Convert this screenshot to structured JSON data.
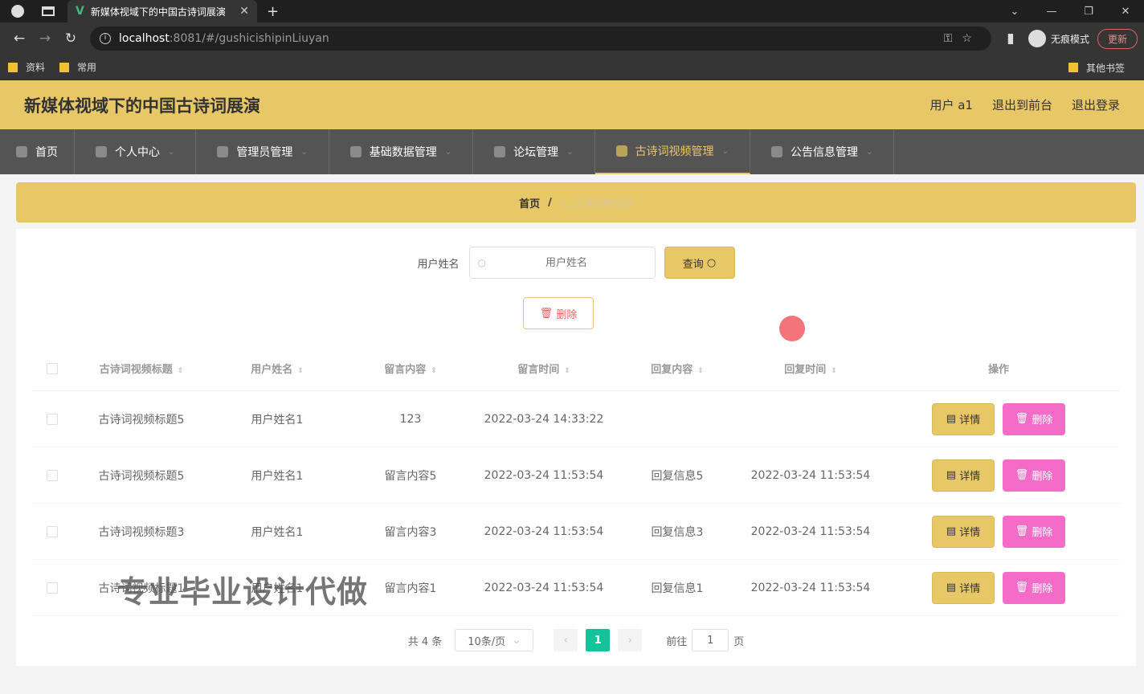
{
  "browser": {
    "tab_title": "新媒体视域下的中国古诗词展演",
    "url_host": "localhost",
    "url_path": ":8081/#/gushicishipinLiuyan",
    "incognito_label": "无痕模式",
    "update_label": "更新",
    "bookmarks": [
      "资料",
      "常用"
    ],
    "other_bookmarks": "其他书签"
  },
  "header": {
    "title": "新媒体视域下的中国古诗词展演",
    "user": "用户 a1",
    "to_front": "退出到前台",
    "logout": "退出登录"
  },
  "menu": [
    {
      "label": "首页",
      "icon": "home-icon"
    },
    {
      "label": "个人中心",
      "icon": "user-icon"
    },
    {
      "label": "管理员管理",
      "icon": "send-icon"
    },
    {
      "label": "基础数据管理",
      "icon": "data-icon"
    },
    {
      "label": "论坛管理",
      "icon": "forum-icon"
    },
    {
      "label": "古诗词视频管理",
      "icon": "mic-icon",
      "active": true
    },
    {
      "label": "公告信息管理",
      "icon": "notice-icon"
    }
  ],
  "breadcrumb": {
    "home": "首页",
    "sep": "/",
    "current": "古诗词视频管理"
  },
  "search": {
    "label": "用户姓名",
    "placeholder": "用户姓名",
    "button": "查询"
  },
  "bulk_delete": "删除",
  "table": {
    "headers": [
      "古诗词视频标题",
      "用户姓名",
      "留言内容",
      "留言时间",
      "回复内容",
      "回复时间",
      "操作"
    ],
    "rows": [
      [
        "古诗词视频标题5",
        "用户姓名1",
        "123",
        "2022-03-24 14:33:22",
        "",
        ""
      ],
      [
        "古诗词视频标题5",
        "用户姓名1",
        "留言内容5",
        "2022-03-24 11:53:54",
        "回复信息5",
        "2022-03-24 11:53:54"
      ],
      [
        "古诗词视频标题3",
        "用户姓名1",
        "留言内容3",
        "2022-03-24 11:53:54",
        "回复信息3",
        "2022-03-24 11:53:54"
      ],
      [
        "古诗词视频标题1",
        "用户姓名1",
        "留言内容1",
        "2022-03-24 11:53:54",
        "回复信息1",
        "2022-03-24 11:53:54"
      ]
    ],
    "detail_label": "详情",
    "delete_label": "删除"
  },
  "pagination": {
    "total": "共 4 条",
    "page_size": "10条/页",
    "current": "1",
    "goto_prefix": "前往",
    "goto_value": "1",
    "goto_suffix": "页"
  },
  "watermark": "专业毕业设计代做"
}
